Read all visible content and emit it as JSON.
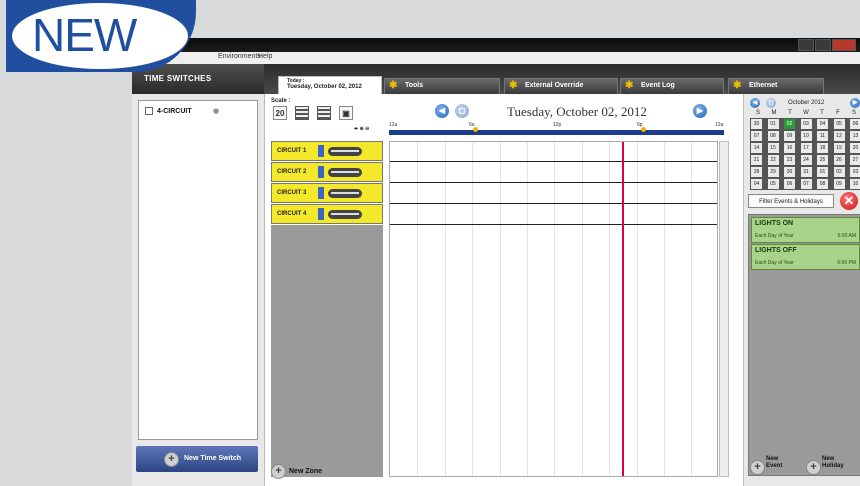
{
  "badge": {
    "text": "NEW"
  },
  "menu": {
    "environments": "Environments",
    "help": "Help"
  },
  "sidebar": {
    "title": "TIME SWITCHES",
    "items": [
      {
        "label": "4-CIRCUIT"
      }
    ],
    "new_button": "New Time Switch"
  },
  "tabs": {
    "today_label": "Today :",
    "today_date": "Tuesday, October 02, 2012",
    "tools": "Tools",
    "external_override": "External Override",
    "event_log": "Event Log",
    "ethernet": "Ethernet"
  },
  "main": {
    "scale_label": "Scale :",
    "day_number": "20",
    "date_header": "Tuesday, October 02, 2012",
    "ruler_ticks": [
      "12a",
      "6a",
      "12p",
      "6p",
      "12a"
    ],
    "circuits": [
      {
        "name": "CIRCUIT 1"
      },
      {
        "name": "CIRCUIT 2"
      },
      {
        "name": "CIRCUIT 3"
      },
      {
        "name": "CIRCUIT 4"
      }
    ],
    "new_zone": "New Zone"
  },
  "calendar": {
    "month": "October 2012",
    "days_of_week": [
      "S",
      "M",
      "T",
      "W",
      "T",
      "F",
      "S"
    ],
    "weeks": [
      [
        "30",
        "01",
        "02",
        "03",
        "04",
        "05",
        "06"
      ],
      [
        "07",
        "08",
        "09",
        "10",
        "11",
        "12",
        "13"
      ],
      [
        "14",
        "15",
        "16",
        "17",
        "18",
        "19",
        "20"
      ],
      [
        "21",
        "22",
        "23",
        "24",
        "25",
        "26",
        "27"
      ],
      [
        "28",
        "29",
        "30",
        "31",
        "01",
        "02",
        "03"
      ],
      [
        "04",
        "05",
        "06",
        "07",
        "08",
        "09",
        "10"
      ]
    ],
    "today": "02"
  },
  "events_panel": {
    "filter_label": "Filter Events & Holidays",
    "events": [
      {
        "title": "LIGHTS ON",
        "recurrence": "Each Day of Year",
        "time": "6:00 AM"
      },
      {
        "title": "LIGHTS OFF",
        "recurrence": "Each Day of Year",
        "time": "6:00 PM"
      }
    ],
    "new_event_line1": "New",
    "new_event_line2": "Event",
    "new_holiday_line1": "New",
    "new_holiday_line2": "Holiday"
  }
}
